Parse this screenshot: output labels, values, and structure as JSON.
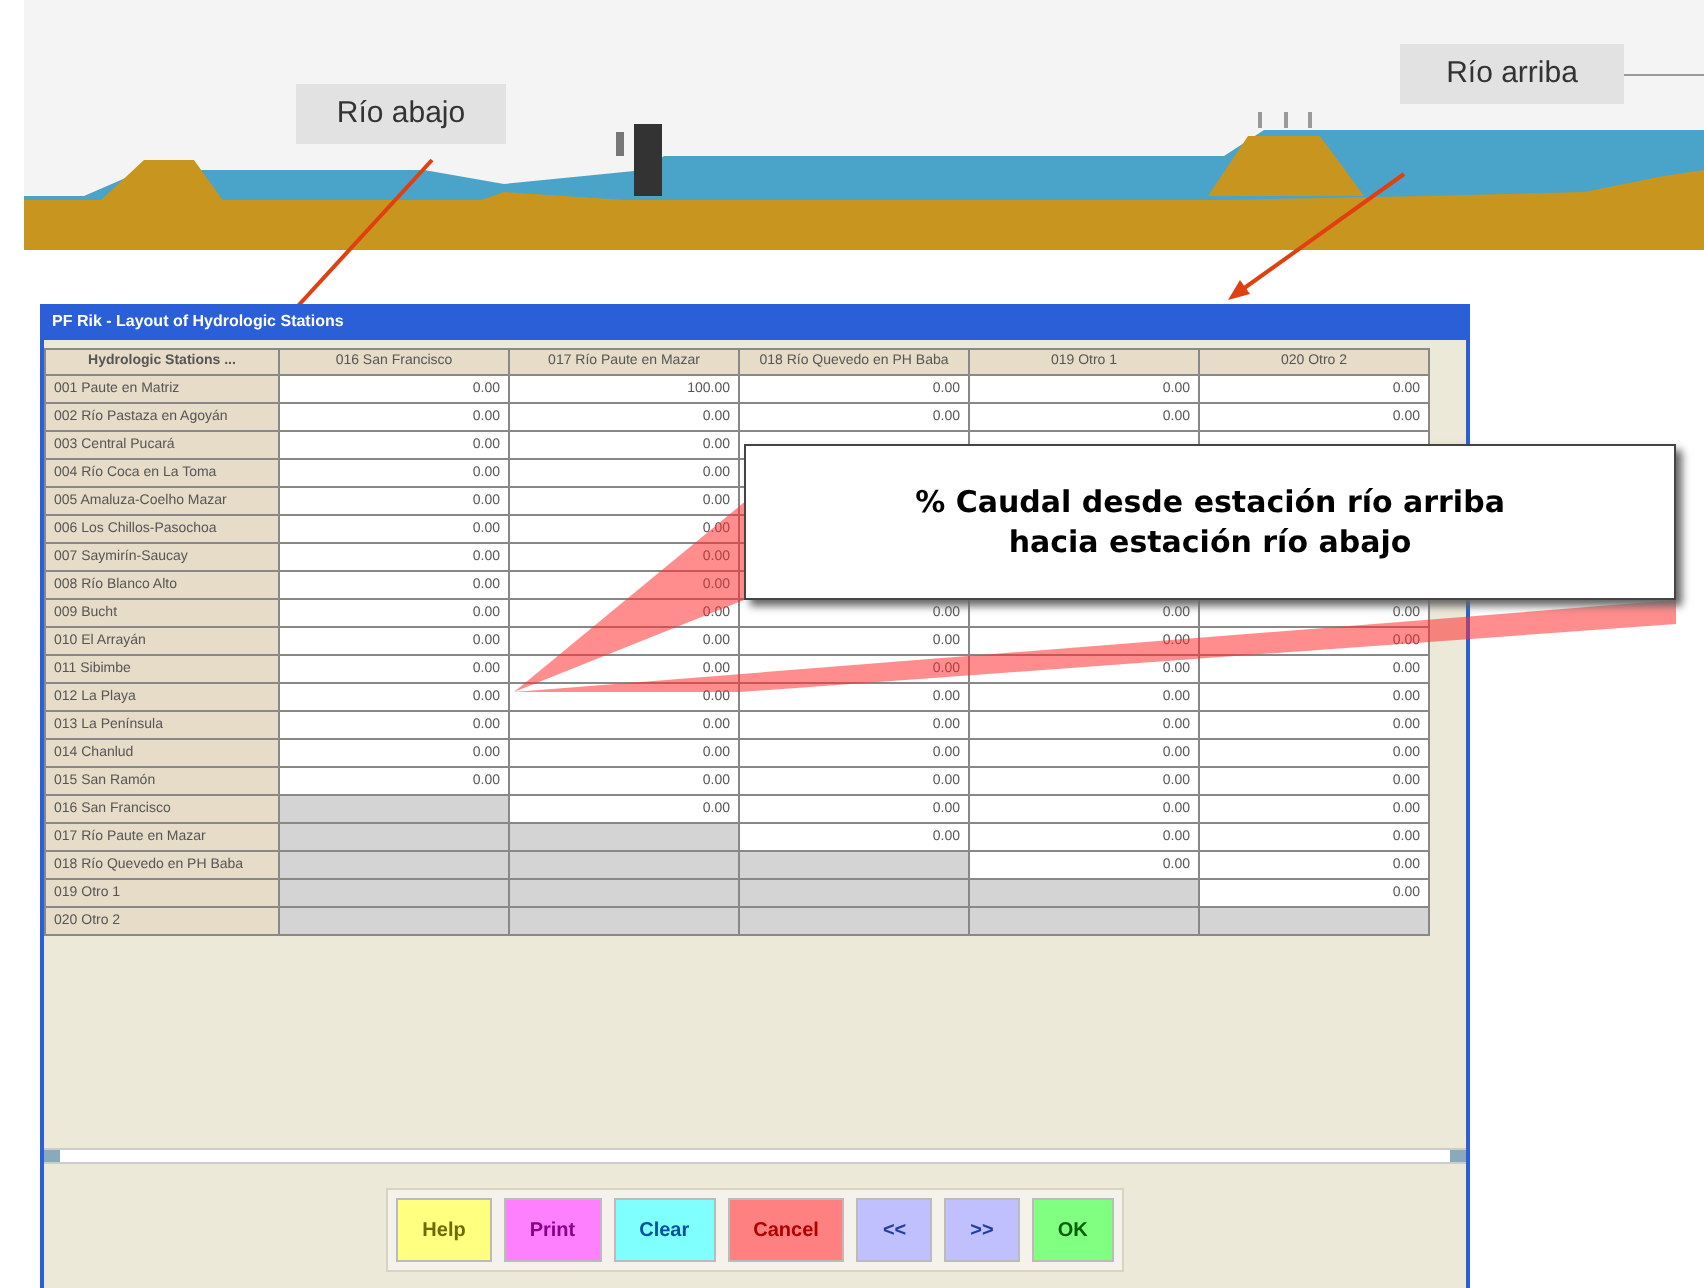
{
  "diagram": {
    "labels": [
      {
        "text": "Río abajo"
      },
      {
        "text": "Río arriba"
      }
    ]
  },
  "window": {
    "title": "PF Rik - Layout of Hydrologic Stations"
  },
  "table": {
    "corner": "Hydrologic Stations ...",
    "columns": [
      "016 San Francisco",
      "017 Río Paute en Mazar",
      "018 Río Quevedo en PH Baba",
      "019 Otro 1",
      "020 Otro 2"
    ],
    "rows": [
      {
        "label": "001 Paute en Matriz",
        "cells": [
          {
            "kind": "value",
            "text": "0.00"
          },
          {
            "kind": "value",
            "text": "100.00"
          },
          {
            "kind": "value",
            "text": "0.00"
          },
          {
            "kind": "value",
            "text": "0.00"
          },
          {
            "kind": "value",
            "text": "0.00"
          }
        ]
      },
      {
        "label": "002 Río Pastaza en Agoyán",
        "cells": [
          {
            "kind": "value",
            "text": "0.00"
          },
          {
            "kind": "value",
            "text": "0.00"
          },
          {
            "kind": "value",
            "text": "0.00"
          },
          {
            "kind": "value",
            "text": "0.00"
          },
          {
            "kind": "value",
            "text": "0.00"
          }
        ]
      },
      {
        "label": "003 Central Pucará",
        "cells": [
          {
            "kind": "value",
            "text": "0.00"
          },
          {
            "kind": "value",
            "text": "0.00"
          },
          {
            "kind": "blank"
          },
          {
            "kind": "blank"
          },
          {
            "kind": "blank"
          }
        ]
      },
      {
        "label": "004 Río Coca en La Toma",
        "cells": [
          {
            "kind": "value",
            "text": "0.00"
          },
          {
            "kind": "value",
            "text": "0.00"
          },
          {
            "kind": "hidden"
          },
          {
            "kind": "hidden"
          },
          {
            "kind": "hidden"
          }
        ]
      },
      {
        "label": "005 Amaluza-Coelho Mazar",
        "cells": [
          {
            "kind": "value",
            "text": "0.00"
          },
          {
            "kind": "value",
            "text": "0.00"
          },
          {
            "kind": "hidden"
          },
          {
            "kind": "hidden"
          },
          {
            "kind": "hidden"
          }
        ]
      },
      {
        "label": "006 Los Chillos-Pasochoa",
        "cells": [
          {
            "kind": "value",
            "text": "0.00"
          },
          {
            "kind": "value",
            "text": "0.00"
          },
          {
            "kind": "hidden"
          },
          {
            "kind": "hidden"
          },
          {
            "kind": "hidden"
          }
        ]
      },
      {
        "label": "007 Saymirín-Saucay",
        "cells": [
          {
            "kind": "value",
            "text": "0.00"
          },
          {
            "kind": "value",
            "text": "0.00"
          },
          {
            "kind": "hidden"
          },
          {
            "kind": "hidden"
          },
          {
            "kind": "hidden"
          }
        ]
      },
      {
        "label": "008 Río Blanco Alto",
        "cells": [
          {
            "kind": "value",
            "text": "0.00"
          },
          {
            "kind": "value",
            "text": "0.00"
          },
          {
            "kind": "hidden"
          },
          {
            "kind": "hidden"
          },
          {
            "kind": "hidden"
          }
        ]
      },
      {
        "label": "009 Bucht",
        "cells": [
          {
            "kind": "value",
            "text": "0.00"
          },
          {
            "kind": "value",
            "text": "0.00"
          },
          {
            "kind": "value",
            "text": "0.00"
          },
          {
            "kind": "value",
            "text": "0.00"
          },
          {
            "kind": "value",
            "text": "0.00"
          }
        ]
      },
      {
        "label": "010 El Arrayán",
        "cells": [
          {
            "kind": "value",
            "text": "0.00"
          },
          {
            "kind": "value",
            "text": "0.00"
          },
          {
            "kind": "value",
            "text": "0.00"
          },
          {
            "kind": "value",
            "text": "0.00"
          },
          {
            "kind": "value",
            "text": "0.00"
          }
        ]
      },
      {
        "label": "011 Sibimbe",
        "cells": [
          {
            "kind": "value",
            "text": "0.00"
          },
          {
            "kind": "value",
            "text": "0.00"
          },
          {
            "kind": "value",
            "text": "0.00"
          },
          {
            "kind": "value",
            "text": "0.00"
          },
          {
            "kind": "value",
            "text": "0.00"
          }
        ]
      },
      {
        "label": "012 La Playa",
        "cells": [
          {
            "kind": "value",
            "text": "0.00"
          },
          {
            "kind": "value",
            "text": "0.00"
          },
          {
            "kind": "value",
            "text": "0.00"
          },
          {
            "kind": "value",
            "text": "0.00"
          },
          {
            "kind": "value",
            "text": "0.00"
          }
        ]
      },
      {
        "label": "013 La Península",
        "cells": [
          {
            "kind": "value",
            "text": "0.00"
          },
          {
            "kind": "value",
            "text": "0.00"
          },
          {
            "kind": "value",
            "text": "0.00"
          },
          {
            "kind": "value",
            "text": "0.00"
          },
          {
            "kind": "value",
            "text": "0.00"
          }
        ]
      },
      {
        "label": "014 Chanlud",
        "cells": [
          {
            "kind": "value",
            "text": "0.00"
          },
          {
            "kind": "value",
            "text": "0.00"
          },
          {
            "kind": "value",
            "text": "0.00"
          },
          {
            "kind": "value",
            "text": "0.00"
          },
          {
            "kind": "value",
            "text": "0.00"
          }
        ]
      },
      {
        "label": "015 San Ramón",
        "cells": [
          {
            "kind": "value",
            "text": "0.00"
          },
          {
            "kind": "value",
            "text": "0.00"
          },
          {
            "kind": "value",
            "text": "0.00"
          },
          {
            "kind": "value",
            "text": "0.00"
          },
          {
            "kind": "value",
            "text": "0.00"
          }
        ]
      },
      {
        "label": "016 San Francisco",
        "cells": [
          {
            "kind": "disabled"
          },
          {
            "kind": "value",
            "text": "0.00"
          },
          {
            "kind": "value",
            "text": "0.00"
          },
          {
            "kind": "value",
            "text": "0.00"
          },
          {
            "kind": "value",
            "text": "0.00"
          }
        ]
      },
      {
        "label": "017 Río Paute en Mazar",
        "cells": [
          {
            "kind": "disabled"
          },
          {
            "kind": "disabled"
          },
          {
            "kind": "value",
            "text": "0.00"
          },
          {
            "kind": "value",
            "text": "0.00"
          },
          {
            "kind": "value",
            "text": "0.00"
          }
        ]
      },
      {
        "label": "018 Río Quevedo en PH Baba",
        "cells": [
          {
            "kind": "disabled"
          },
          {
            "kind": "disabled"
          },
          {
            "kind": "disabled"
          },
          {
            "kind": "value",
            "text": "0.00"
          },
          {
            "kind": "value",
            "text": "0.00"
          }
        ]
      },
      {
        "label": "019 Otro 1",
        "cells": [
          {
            "kind": "disabled"
          },
          {
            "kind": "disabled"
          },
          {
            "kind": "disabled"
          },
          {
            "kind": "disabled"
          },
          {
            "kind": "value",
            "text": "0.00"
          }
        ]
      },
      {
        "label": "020 Otro 2",
        "cells": [
          {
            "kind": "disabled"
          },
          {
            "kind": "disabled"
          },
          {
            "kind": "disabled"
          },
          {
            "kind": "disabled"
          },
          {
            "kind": "disabled"
          }
        ]
      }
    ]
  },
  "callout": {
    "lines": [
      "% Caudal desde estación río arriba",
      "hacia estación río abajo"
    ]
  },
  "buttons": [
    {
      "label": "Help",
      "color": "#ffff80"
    },
    {
      "label": "Print",
      "color": "#ff80ff"
    },
    {
      "label": "Clear",
      "color": "#80ffff"
    },
    {
      "label": "Cancel",
      "color": "#ff8080"
    },
    {
      "label": "<<",
      "color": "#c0c0ff"
    },
    {
      "label": ">>",
      "color": "#c0c0ff"
    },
    {
      "label": "OK",
      "color": "#80ff80"
    }
  ]
}
